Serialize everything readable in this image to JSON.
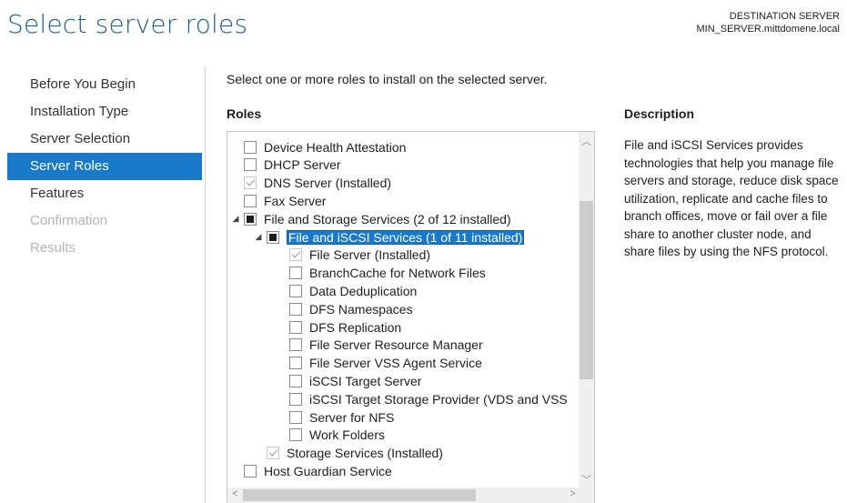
{
  "header": {
    "title": "Select server roles",
    "destination_label": "DESTINATION SERVER",
    "destination_server": "MIN_SERVER.mittdomene.local"
  },
  "nav": {
    "items": [
      {
        "label": "Before You Begin",
        "state": "normal"
      },
      {
        "label": "Installation Type",
        "state": "normal"
      },
      {
        "label": "Server Selection",
        "state": "normal"
      },
      {
        "label": "Server Roles",
        "state": "active"
      },
      {
        "label": "Features",
        "state": "normal"
      },
      {
        "label": "Confirmation",
        "state": "disabled"
      },
      {
        "label": "Results",
        "state": "disabled"
      }
    ]
  },
  "main": {
    "instruction": "Select one or more roles to install on the selected server.",
    "roles_heading": "Roles",
    "description_heading": "Description",
    "description_text": "File and iSCSI Services provides technologies that help you manage file servers and storage, reduce disk space utilization, replicate and cache files to branch offices, move or fail over a file share to another cluster node, and share files by using the NFS protocol."
  },
  "roles": [
    {
      "label": "Device Health Attestation",
      "level": 0,
      "state": "unchecked",
      "expander": ""
    },
    {
      "label": "DHCP Server",
      "level": 0,
      "state": "unchecked",
      "expander": ""
    },
    {
      "label": "DNS Server (Installed)",
      "level": 0,
      "state": "checked",
      "expander": ""
    },
    {
      "label": "Fax Server",
      "level": 0,
      "state": "unchecked",
      "expander": ""
    },
    {
      "label": "File and Storage Services (2 of 12 installed)",
      "level": 0,
      "state": "partial",
      "expander": "◢"
    },
    {
      "label": "File and iSCSI Services (1 of 11 installed)",
      "level": 1,
      "state": "partial",
      "expander": "◢",
      "selected": true
    },
    {
      "label": "File Server (Installed)",
      "level": 2,
      "state": "checked",
      "expander": ""
    },
    {
      "label": "BranchCache for Network Files",
      "level": 2,
      "state": "unchecked",
      "expander": ""
    },
    {
      "label": "Data Deduplication",
      "level": 2,
      "state": "unchecked",
      "expander": ""
    },
    {
      "label": "DFS Namespaces",
      "level": 2,
      "state": "unchecked",
      "expander": ""
    },
    {
      "label": "DFS Replication",
      "level": 2,
      "state": "unchecked",
      "expander": ""
    },
    {
      "label": "File Server Resource Manager",
      "level": 2,
      "state": "unchecked",
      "expander": ""
    },
    {
      "label": "File Server VSS Agent Service",
      "level": 2,
      "state": "unchecked",
      "expander": ""
    },
    {
      "label": "iSCSI Target Server",
      "level": 2,
      "state": "unchecked",
      "expander": ""
    },
    {
      "label": "iSCSI Target Storage Provider (VDS and VSS",
      "level": 2,
      "state": "unchecked",
      "expander": ""
    },
    {
      "label": "Server for NFS",
      "level": 2,
      "state": "unchecked",
      "expander": ""
    },
    {
      "label": "Work Folders",
      "level": 2,
      "state": "unchecked",
      "expander": ""
    },
    {
      "label": "Storage Services (Installed)",
      "level": 1,
      "state": "checked",
      "expander": ""
    },
    {
      "label": "Host Guardian Service",
      "level": 0,
      "state": "unchecked",
      "expander": ""
    }
  ],
  "scrollbar": {
    "up": "︿",
    "down": "﹀",
    "left": "<",
    "right": ">"
  },
  "colors": {
    "accent": "#1979ca",
    "title": "#1f5b8f",
    "disabled": "#b5b5b5"
  }
}
